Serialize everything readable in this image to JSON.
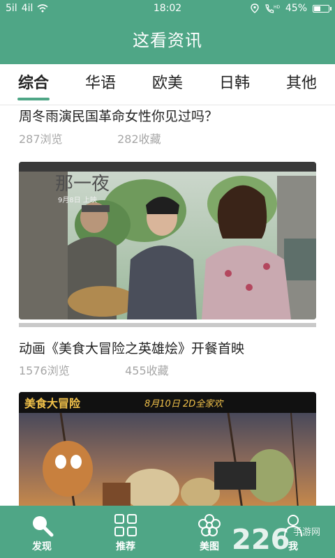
{
  "status": {
    "signal_left": "5il",
    "signal_right": "4il",
    "time": "18:02",
    "battery": "45%",
    "battery_level": 0.45
  },
  "header": {
    "title": "这看资讯"
  },
  "tabs": [
    {
      "label": "综合",
      "active": true
    },
    {
      "label": "华语"
    },
    {
      "label": "欧美"
    },
    {
      "label": "日韩"
    },
    {
      "label": "其他"
    }
  ],
  "feed": [
    {
      "title": "周冬雨演民国革命女性你见过吗？",
      "views": "287浏览",
      "favorites": "282收藏"
    },
    {
      "title": "动画《美食大冒险之英雄烩》开餐首映",
      "views": "1576浏览",
      "favorites": "455收藏"
    }
  ],
  "images": {
    "poster1_text": "那一夜",
    "poster1_sub": "9月8日 上映",
    "poster2_text": "美食大冒险",
    "poster2_date": "8月10日 2D全家欢"
  },
  "bottom_nav": [
    {
      "label": "发现",
      "icon": "search-icon"
    },
    {
      "label": "推荐",
      "icon": "grid-icon"
    },
    {
      "label": "美图",
      "icon": "flower-icon"
    },
    {
      "label": "我",
      "icon": "person-icon"
    }
  ],
  "watermark": {
    "text": "226",
    "sub": "手游网"
  },
  "colors": {
    "brand": "#4fa686",
    "meta": "#a6a6a6"
  }
}
